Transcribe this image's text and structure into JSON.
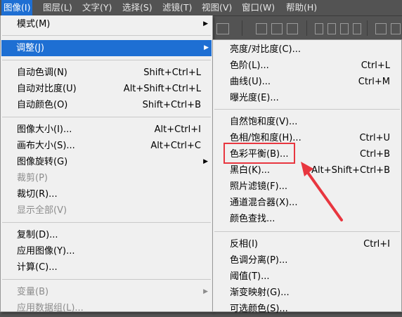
{
  "menubar": {
    "items": [
      "图像(I)",
      "图层(L)",
      "文字(Y)",
      "选择(S)",
      "滤镜(T)",
      "视图(V)",
      "窗口(W)",
      "帮助(H)"
    ]
  },
  "image_menu": [
    {
      "label": "模式(M)",
      "shortcut": "",
      "submenu": true,
      "disabled": false
    },
    {
      "label": "调整(J)",
      "shortcut": "",
      "submenu": true,
      "disabled": false,
      "highlighted": true
    },
    {
      "label": "自动色调(N)",
      "shortcut": "Shift+Ctrl+L",
      "disabled": false
    },
    {
      "label": "自动对比度(U)",
      "shortcut": "Alt+Shift+Ctrl+L",
      "disabled": false
    },
    {
      "label": "自动颜色(O)",
      "shortcut": "Shift+Ctrl+B",
      "disabled": false
    },
    {
      "label": "图像大小(I)...",
      "shortcut": "Alt+Ctrl+I",
      "disabled": false
    },
    {
      "label": "画布大小(S)...",
      "shortcut": "Alt+Ctrl+C",
      "disabled": false
    },
    {
      "label": "图像旋转(G)",
      "shortcut": "",
      "submenu": true,
      "disabled": false
    },
    {
      "label": "裁剪(P)",
      "shortcut": "",
      "disabled": true
    },
    {
      "label": "裁切(R)...",
      "shortcut": "",
      "disabled": false
    },
    {
      "label": "显示全部(V)",
      "shortcut": "",
      "disabled": true
    },
    {
      "label": "复制(D)...",
      "shortcut": "",
      "disabled": false
    },
    {
      "label": "应用图像(Y)...",
      "shortcut": "",
      "disabled": false
    },
    {
      "label": "计算(C)...",
      "shortcut": "",
      "disabled": false
    },
    {
      "label": "变量(B)",
      "shortcut": "",
      "submenu": true,
      "disabled": true
    },
    {
      "label": "应用数据组(L)...",
      "shortcut": "",
      "disabled": true
    }
  ],
  "adjust_menu": [
    {
      "label": "亮度/对比度(C)...",
      "shortcut": ""
    },
    {
      "label": "色阶(L)...",
      "shortcut": "Ctrl+L"
    },
    {
      "label": "曲线(U)...",
      "shortcut": "Ctrl+M"
    },
    {
      "label": "曝光度(E)...",
      "shortcut": ""
    },
    {
      "label": "自然饱和度(V)...",
      "shortcut": ""
    },
    {
      "label": "色相/饱和度(H)...",
      "shortcut": "Ctrl+U"
    },
    {
      "label": "色彩平衡(B)...",
      "shortcut": "Ctrl+B",
      "annotated": true
    },
    {
      "label": "黑白(K)...",
      "shortcut": "Alt+Shift+Ctrl+B"
    },
    {
      "label": "照片滤镜(F)...",
      "shortcut": ""
    },
    {
      "label": "通道混合器(X)...",
      "shortcut": ""
    },
    {
      "label": "颜色查找...",
      "shortcut": ""
    },
    {
      "label": "反相(I)",
      "shortcut": "Ctrl+I"
    },
    {
      "label": "色调分离(P)...",
      "shortcut": ""
    },
    {
      "label": "阈值(T)...",
      "shortcut": ""
    },
    {
      "label": "渐变映射(G)...",
      "shortcut": ""
    },
    {
      "label": "可选颜色(S)...",
      "shortcut": ""
    }
  ],
  "colors": {
    "highlight": "#1e6fd3",
    "annotation": "#e8363f",
    "menu_bg": "#f0f0f0",
    "app_bg": "#535353"
  },
  "icons": {
    "submenu": "chevron-right-icon"
  }
}
